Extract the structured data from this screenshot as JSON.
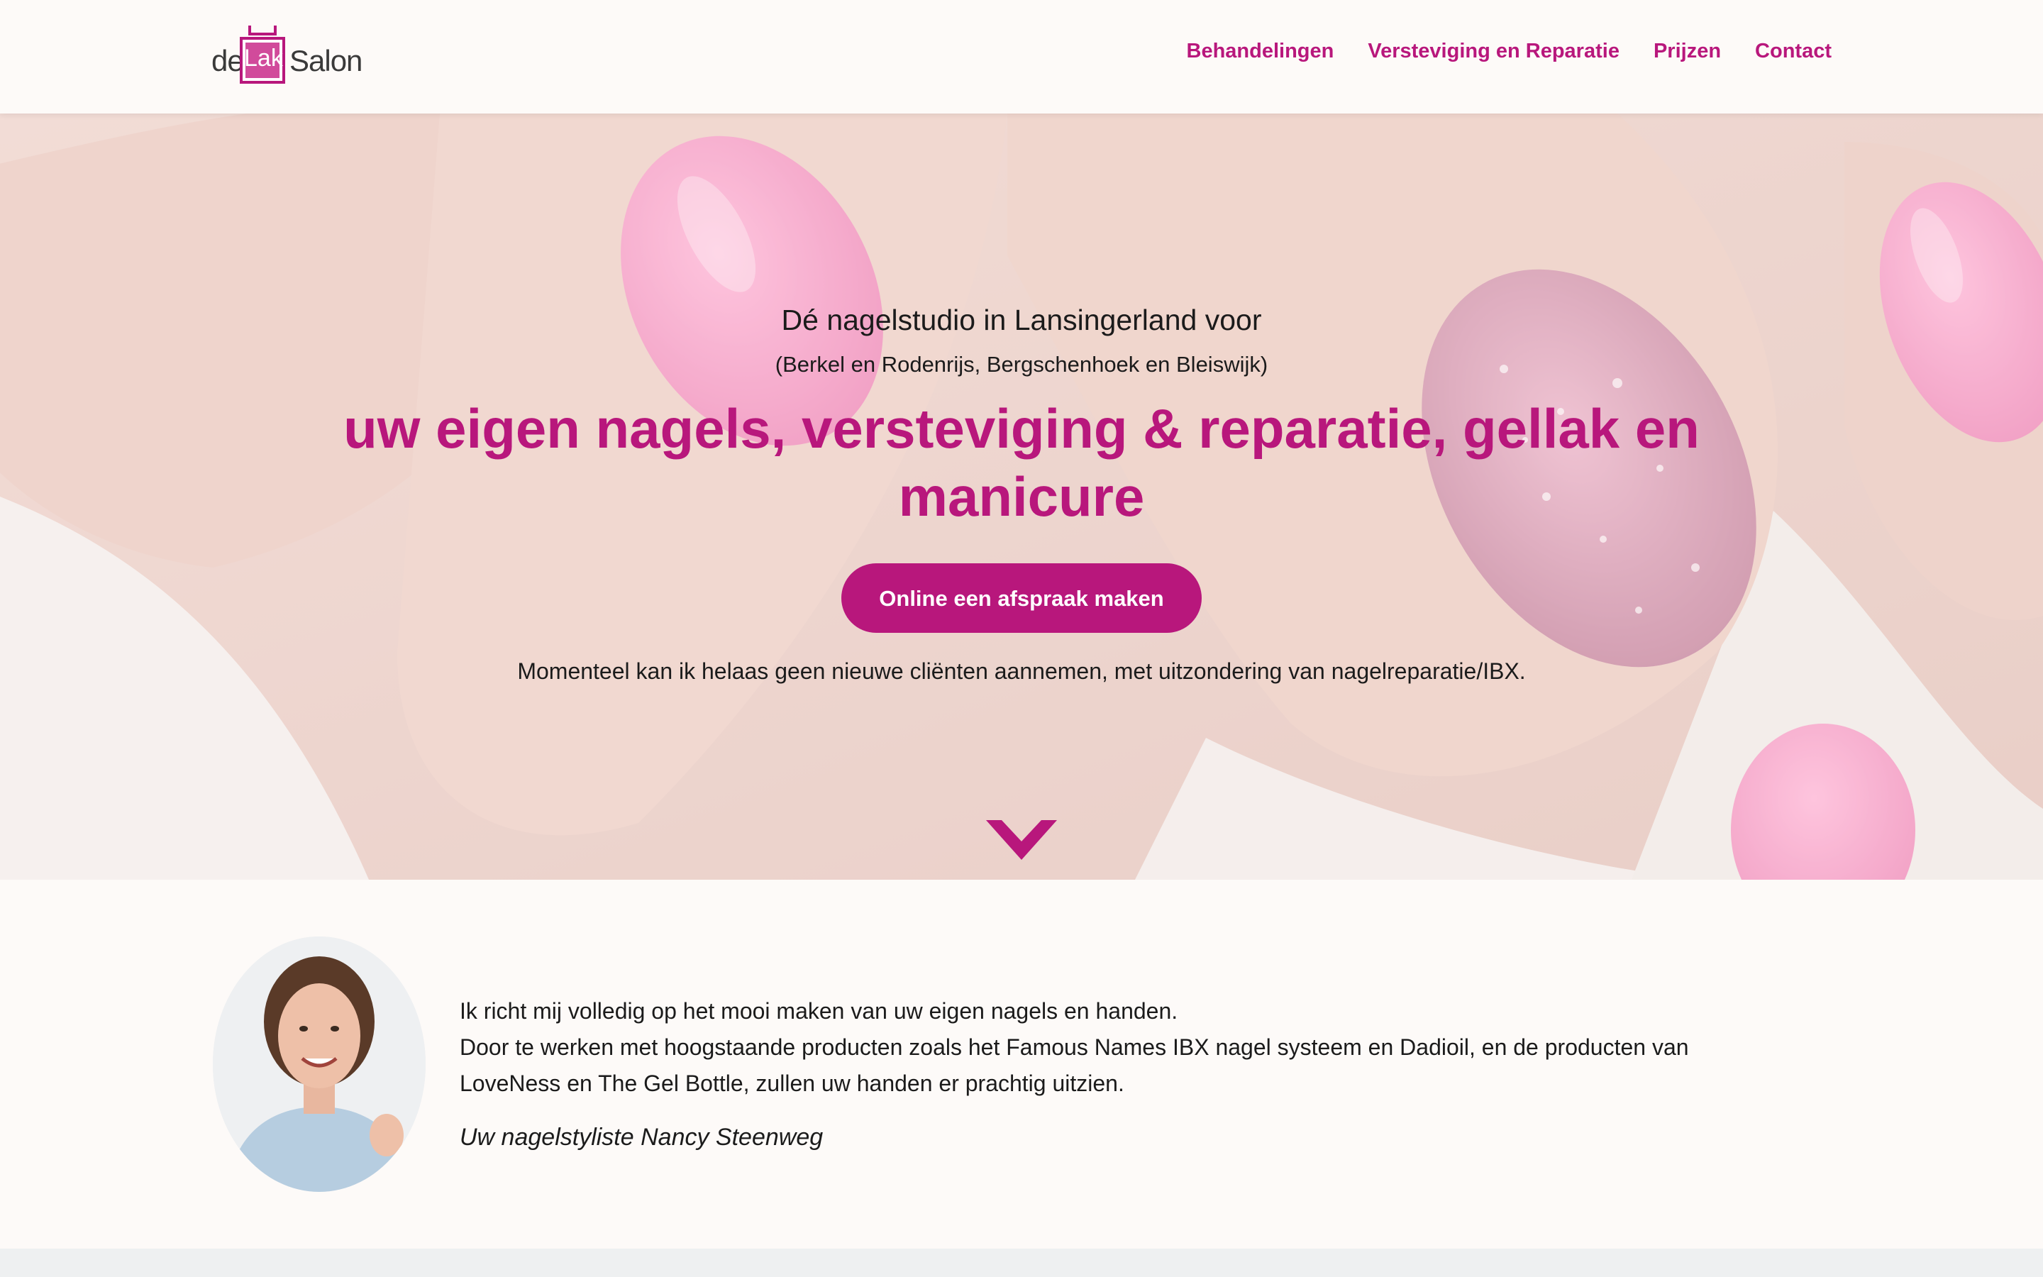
{
  "brand": {
    "logo_prefix": "de",
    "logo_highlight": "Lak",
    "logo_suffix": "Salon",
    "accent_color": "#b8177c"
  },
  "nav": {
    "items": [
      {
        "label": "Behandelingen"
      },
      {
        "label": "Versteviging en Reparatie"
      },
      {
        "label": "Prijzen"
      },
      {
        "label": "Contact"
      }
    ]
  },
  "hero": {
    "subtitle": "Dé nagelstudio in Lansingerland voor",
    "locations": "(Berkel en Rodenrijs, Bergschenhoek en Bleiswijk)",
    "title": "uw eigen nagels, versteviging & reparatie, gellak en manicure",
    "cta_label": "Online een afspraak maken",
    "notice": "Momenteel kan ik helaas geen nieuwe cliënten aannemen, met uitzondering van nagelreparatie/IBX.",
    "scroll_icon": "chevron-down-icon"
  },
  "about": {
    "line1": "Ik richt mij volledig op het mooi maken van uw eigen nagels en handen.",
    "line2": "Door te werken met hoogstaande producten zoals het Famous Names IBX nagel systeem en Dadioil, en de producten van LoveNess en The Gel Bottle, zullen uw handen er prachtig uitzien.",
    "signature": "Uw nagelstyliste Nancy Steenweg"
  }
}
